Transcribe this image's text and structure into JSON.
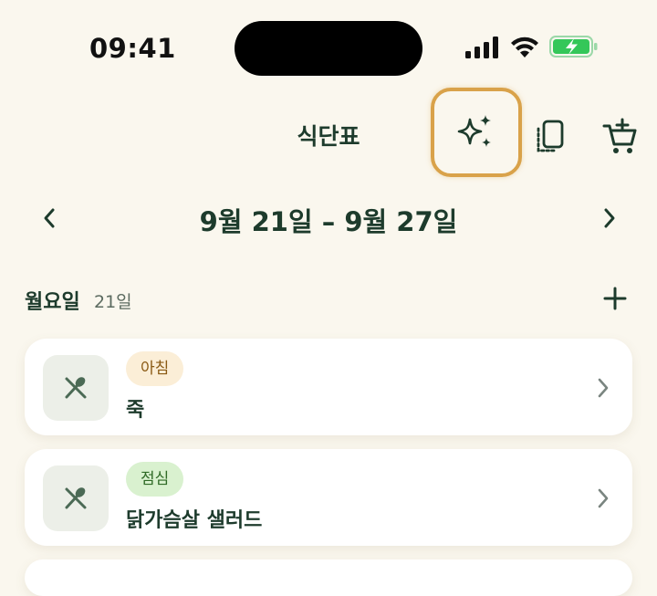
{
  "status_bar": {
    "time": "09:41",
    "icons": [
      "cellular-signal-icon",
      "wifi-icon",
      "battery-charging-icon"
    ],
    "battery_color": "#34c759"
  },
  "header": {
    "title": "식단표",
    "actions": [
      "sparkle-icon",
      "copy-pages-icon",
      "cart-add-icon"
    ],
    "highlight_color": "#d9a24a"
  },
  "week_nav": {
    "label": "9월 21일 – 9월 27일"
  },
  "day": {
    "name": "월요일",
    "date": "21일"
  },
  "meals": [
    {
      "badge": "아침",
      "name": "죽",
      "badge_color": "#fbeed7"
    },
    {
      "badge": "점심",
      "name": "닭가슴살 샐러드",
      "badge_color": "#d9f1cf"
    }
  ],
  "colors": {
    "primary_text": "#1d3b2c",
    "background": "#faf7ee"
  }
}
